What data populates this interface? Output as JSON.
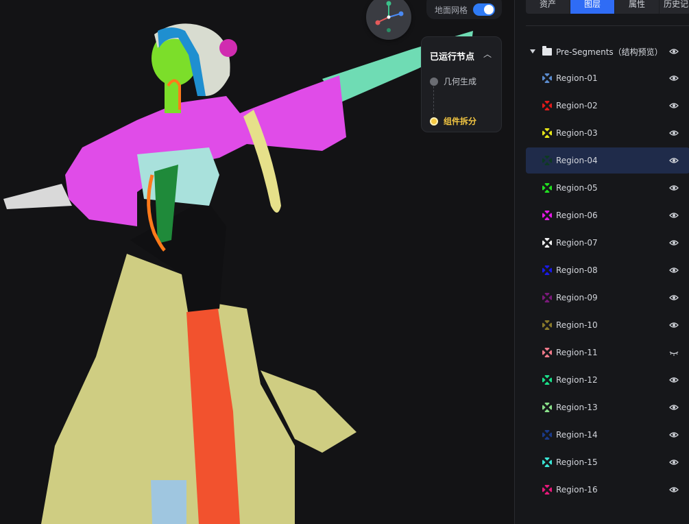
{
  "viewport": {
    "grid_toggle_label": "地面网格",
    "grid_toggle_on": true,
    "nodes_panel": {
      "title": "已运行节点",
      "nodes": [
        {
          "label": "几何生成",
          "state": "done"
        },
        {
          "label": "组件拆分",
          "state": "active"
        }
      ]
    }
  },
  "panel": {
    "tabs": [
      {
        "label": "资产",
        "active": false
      },
      {
        "label": "图层",
        "active": true
      },
      {
        "label": "属性",
        "active": false
      },
      {
        "label": "历史记",
        "active": false
      }
    ],
    "root": {
      "label": "Pre-Segments（结构预览）",
      "visible": true
    },
    "regions": [
      {
        "label": "Region-01",
        "color": "#5b8ccf",
        "visible": true
      },
      {
        "label": "Region-02",
        "color": "#e01a1a",
        "visible": true
      },
      {
        "label": "Region-03",
        "color": "#e6e619",
        "visible": true
      },
      {
        "label": "Region-04",
        "color": "#0d3a22",
        "visible": true,
        "selected": true
      },
      {
        "label": "Region-05",
        "color": "#22e022",
        "visible": true
      },
      {
        "label": "Region-06",
        "color": "#e619e6",
        "visible": true
      },
      {
        "label": "Region-07",
        "color": "#f0f0f0",
        "visible": true
      },
      {
        "label": "Region-08",
        "color": "#1a1ae6",
        "visible": true
      },
      {
        "label": "Region-09",
        "color": "#7a1a7a",
        "visible": true
      },
      {
        "label": "Region-10",
        "color": "#8a7a2a",
        "visible": true
      },
      {
        "label": "Region-11",
        "color": "#f07a8a",
        "visible": false
      },
      {
        "label": "Region-12",
        "color": "#1ae08a",
        "visible": true
      },
      {
        "label": "Region-13",
        "color": "#8ae08a",
        "visible": true
      },
      {
        "label": "Region-14",
        "color": "#1a3a8a",
        "visible": true
      },
      {
        "label": "Region-15",
        "color": "#3ae6d6",
        "visible": true
      },
      {
        "label": "Region-16",
        "color": "#e6197a",
        "visible": true
      }
    ]
  }
}
